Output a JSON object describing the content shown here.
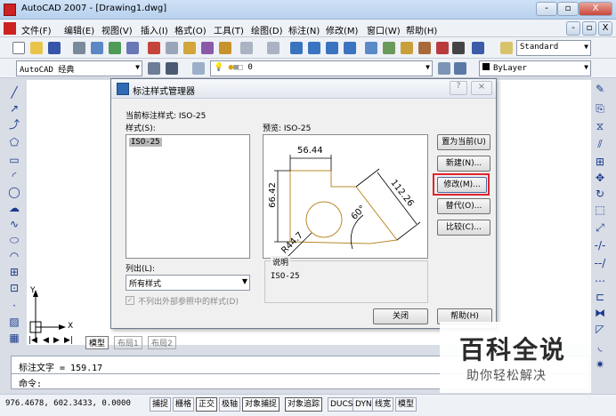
{
  "window": {
    "title": "AutoCAD 2007 - [Drawing1.dwg]",
    "min": "-",
    "restore": "▫",
    "close": "X",
    "doc_controls": [
      "-",
      "▫",
      "X"
    ]
  },
  "menu": [
    "文件(F)",
    "编辑(E)",
    "视图(V)",
    "插入(I)",
    "格式(O)",
    "工具(T)",
    "绘图(D)",
    "标注(N)",
    "修改(M)",
    "窗口(W)",
    "帮助(H)"
  ],
  "toolbar": {
    "text_style": "Standard",
    "workspace": "AutoCAD 经典",
    "layer": "0",
    "color": "ByLayer"
  },
  "tabs": [
    "模型",
    "布局1",
    "布局2"
  ],
  "axis": {
    "y": "Y",
    "x": "X"
  },
  "command": {
    "line1": "标注文字 = 159.17",
    "line2": "命令:"
  },
  "status": {
    "coords": "976.4678,  602.3433, 0.0000",
    "buttons": [
      "捕捉",
      "栅格",
      "正交",
      "极轴",
      "对象捕捉",
      "对象追踪",
      "DUCS",
      "DYN",
      "线宽",
      "模型"
    ]
  },
  "dialog": {
    "title": "标注样式管理器",
    "help_icon": "?",
    "close": "×",
    "current_style": "当前标注样式: ISO-25",
    "styles_label": "样式(S):",
    "styles": [
      "ISO-25"
    ],
    "preview_label": "预览: ISO-25",
    "list_label": "列出(L):",
    "list_value": "所有样式",
    "checkbox_label": "不列出外部参照中的样式(D)",
    "desc_label": "说明",
    "desc_value": "ISO-25",
    "buttons": {
      "set_current": "置为当前(U)",
      "new": "新建(N)...",
      "modify": "修改(M)...",
      "override": "替代(O)...",
      "compare": "比较(C)...",
      "close": "关闭",
      "help": "帮助(H)"
    },
    "preview_dims": {
      "top": "56.44",
      "left": "66.42",
      "right": "112.26",
      "angle": "60°",
      "radius": "R44.7"
    }
  },
  "watermark": {
    "main": "百科全说",
    "sub": "助你轻松解决"
  },
  "colors": {
    "highlight": "#e0242c",
    "title_bar": "#c9dcf3",
    "preview_lines": "#b88a2a"
  }
}
